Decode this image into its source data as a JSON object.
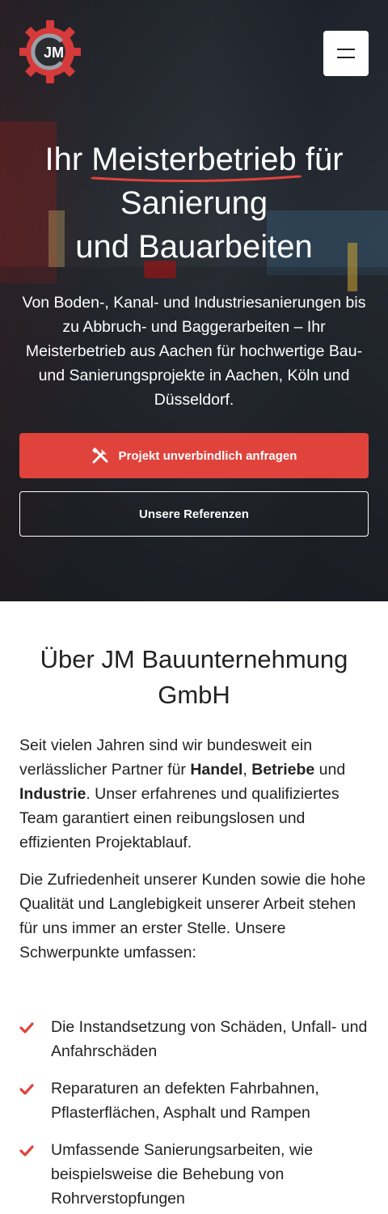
{
  "brand": {
    "logo_text": "JM",
    "accent": "#e0433b"
  },
  "header": {
    "menu_icon": "hamburger-icon"
  },
  "hero": {
    "title_pre": "Ihr",
    "title_highlight": "Meisterbetrieb",
    "title_post": "für",
    "title_line2": "Sanierung",
    "title_line3": "und Bauarbeiten",
    "text": "Von Boden-, Kanal- und Industriesanierungen bis zu Abbruch- und Baggerarbeiten – Ihr Meisterbetrieb aus Aachen für hochwertige Bau- und Sanierungsprojekte in Aachen, Köln und Düsseldorf.",
    "cta_primary": "Projekt unverbindlich anfragen",
    "cta_primary_icon": "tools-icon",
    "cta_secondary": "Unsere Referenzen"
  },
  "about": {
    "title": "Über JM Bauunternehmung GmbH",
    "p1_a": "Seit vielen Jahren sind wir bundesweit ein verlässlicher Partner für ",
    "p1_b1": "Handel",
    "p1_sep": ", ",
    "p1_b2": "Betriebe",
    "p1_and": " und ",
    "p1_b3": "Industrie",
    "p1_c": ". Unser erfahrenes und qualifiziertes Team garantiert einen reibungslosen und effizienten Projektablauf.",
    "p2": "Die Zufriedenheit unserer Kunden sowie die hohe Qualität und Langlebigkeit unserer Arbeit stehen für uns immer an erster Stelle. Unsere Schwerpunkte umfassen:",
    "list": [
      "Die Instandsetzung von Schäden, Unfall- und Anfahrschäden",
      "Reparaturen an defekten Fahrbahnen, Pflasterflächen, Asphalt und Rampen",
      "Umfassende Sanierungsarbeiten, wie beispielsweise die Behebung von Rohrverstopfungen"
    ]
  }
}
